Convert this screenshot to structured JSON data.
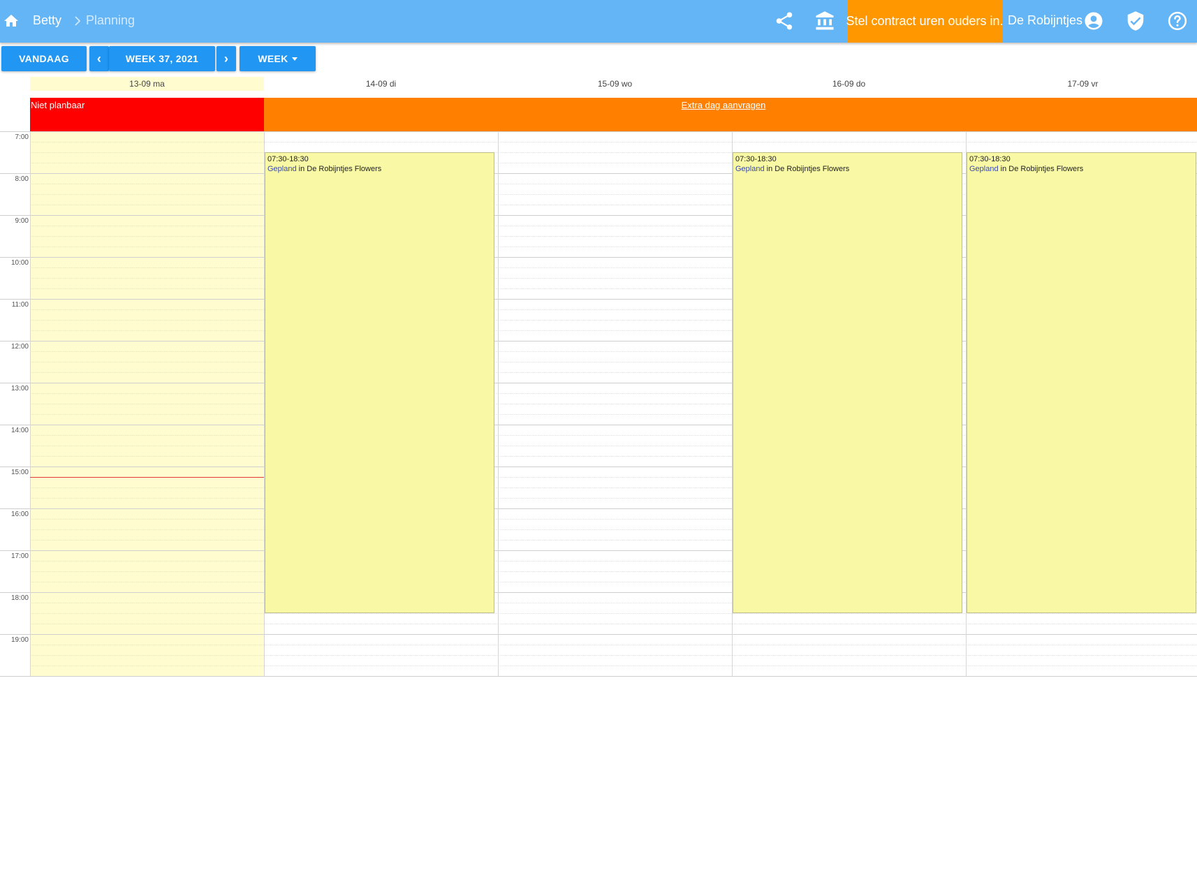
{
  "colors": {
    "topbar": "#64b5f6",
    "accent_button": "#2196f3",
    "alert": "#ff9800",
    "not_plannable": "#ff0000",
    "extra_day": "#ff8000",
    "today_column": "#fffdd0",
    "event": "#f9f9a5",
    "now_line": "#e53935"
  },
  "header": {
    "breadcrumb": {
      "root": "Betty",
      "current": "Planning"
    },
    "icons": [
      "home-icon",
      "chevron-right-icon",
      "share-icon",
      "bank-icon",
      "account-circle-icon",
      "shield-check-icon",
      "help-circle-icon"
    ],
    "alert_button_label": "Stel contract uren ouders in.",
    "org_name": "De Robijntjes"
  },
  "toolbar": {
    "today_label": "VANDAAG",
    "prev_symbol": "‹",
    "week_label": "WEEK 37, 2021",
    "next_symbol": "›",
    "view_label": "WEEK"
  },
  "calendar": {
    "days": [
      "13-09 ma",
      "14-09 di",
      "15-09 wo",
      "16-09 do",
      "17-09 vr"
    ],
    "today_index": 0,
    "allday": {
      "not_plannable_label": "Niet planbaar",
      "extra_day_link": "Extra dag aanvragen"
    },
    "hours": [
      "7:00",
      "8:00",
      "9:00",
      "10:00",
      "11:00",
      "12:00",
      "13:00",
      "14:00",
      "15:00",
      "16:00",
      "17:00",
      "18:00",
      "19:00"
    ],
    "now_time": "15:15",
    "events": [
      {
        "day_index": 1,
        "start": "07:30",
        "end": "18:30",
        "time": "07:30-18:30",
        "status": "Gepland",
        "location": "in De Robijntjes Flowers"
      },
      {
        "day_index": 3,
        "start": "07:30",
        "end": "18:30",
        "time": "07:30-18:30",
        "status": "Gepland",
        "location": "in De Robijntjes Flowers"
      },
      {
        "day_index": 4,
        "start": "07:30",
        "end": "18:30",
        "time": "07:30-18:30",
        "status": "Gepland",
        "location": "in De Robijntjes Flowers"
      }
    ]
  }
}
